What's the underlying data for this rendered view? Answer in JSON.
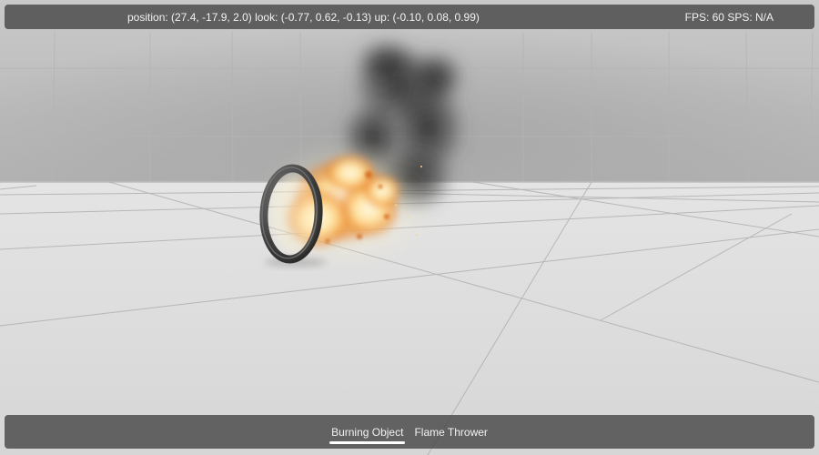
{
  "hud": {
    "camera_readout": "position: (27.4, -17.9, 2.0) look: (-0.77, 0.62, -0.13) up: (-0.10, 0.08, 0.99)",
    "perf_readout": "FPS: 60 SPS: N/A"
  },
  "scene": {
    "object": "ring",
    "effects": [
      "fire",
      "smoke"
    ]
  },
  "tabs": {
    "active_index": 0,
    "items": [
      {
        "label": "Burning Object"
      },
      {
        "label": "Flame Thrower"
      }
    ]
  },
  "colors": {
    "hud_background": "#484848",
    "hud_text": "#f2f2f2",
    "fire_core": "#fff6d8",
    "fire_outer": "#f08a2a",
    "smoke": "#2a2a2a"
  }
}
